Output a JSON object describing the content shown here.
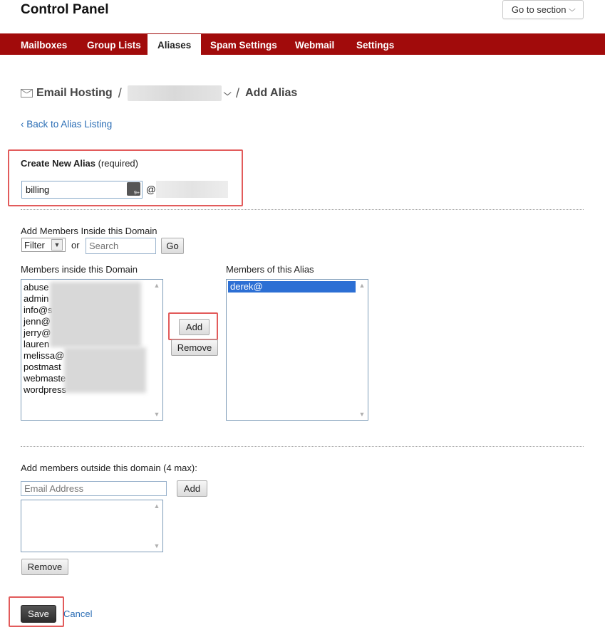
{
  "header": {
    "title": "Control Panel",
    "goto_label": "Go to section"
  },
  "nav": {
    "tabs": [
      {
        "label": "Mailboxes"
      },
      {
        "label": "Group Lists"
      },
      {
        "label": "Aliases"
      },
      {
        "label": "Spam Settings"
      },
      {
        "label": "Webmail"
      },
      {
        "label": "Settings"
      }
    ],
    "active": "Aliases"
  },
  "breadcrumb": {
    "root": "Email Hosting",
    "separator": "/",
    "current": "Add Alias"
  },
  "back_link": "‹ Back to Alias Listing",
  "create_alias": {
    "label": "Create New Alias",
    "required": "(required)",
    "value": "billing",
    "at": "@"
  },
  "add_inside": {
    "label": "Add Members Inside this Domain",
    "filter_value": "Filter",
    "or": "or",
    "search_placeholder": "Search",
    "go_label": "Go"
  },
  "members_inside": {
    "label": "Members inside this Domain",
    "items": [
      "abuse",
      "admin",
      "info@s",
      "jenn@",
      "jerry@",
      "lauren",
      "melissa@",
      "postmast",
      "webmaste",
      "wordpress"
    ]
  },
  "members_alias": {
    "label": "Members of this Alias",
    "items": [
      "derek@"
    ]
  },
  "transfer": {
    "add_label": "Add",
    "remove_label": "Remove"
  },
  "outside": {
    "label": "Add members outside this domain (4 max):",
    "email_placeholder": "Email Address",
    "add_label": "Add",
    "remove_label": "Remove"
  },
  "footer": {
    "save_label": "Save",
    "cancel_label": "Cancel"
  },
  "colors": {
    "nav_bg": "#a10b0b",
    "link": "#2a6db5",
    "highlight": "#e25b5b",
    "selection": "#2c6fd4"
  }
}
